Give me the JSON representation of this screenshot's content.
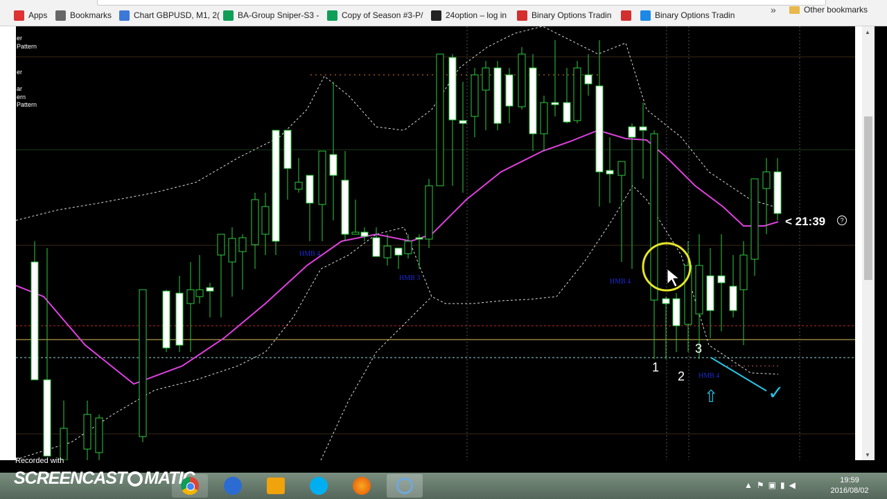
{
  "bookmarks": [
    {
      "label": "Apps",
      "icon": "apps-grid-icon",
      "color": "#d33"
    },
    {
      "label": "Bookmarks",
      "icon": "star-icon",
      "color": "#666"
    },
    {
      "label": "Chart GBPUSD, M1, 2(",
      "icon": "cap-icon",
      "color": "#3c78d8"
    },
    {
      "label": "BA-Group Sniper-S3 -",
      "icon": "sheet-icon",
      "color": "#0f9d58"
    },
    {
      "label": "Copy of Season #3-P/",
      "icon": "sheet-icon",
      "color": "#0f9d58"
    },
    {
      "label": "24option – log in",
      "icon": "24-icon",
      "color": "#222"
    },
    {
      "label": "Binary Options Tradin",
      "icon": "binary-icon",
      "color": "#d32f2f"
    },
    {
      "label": "",
      "icon": "binary-icon",
      "color": "#d32f2f"
    },
    {
      "label": "Binary Options Tradin",
      "icon": "up-arrow-icon",
      "color": "#1e88e5"
    }
  ],
  "bookmarks_overflow": "»",
  "other_bookmarks": "Other bookmarks",
  "chart_overlay": {
    "left_labels": [
      "er",
      "tern",
      "Pattern",
      "er",
      "ar",
      "ern",
      "Pattern"
    ],
    "timer": "< 21:39",
    "timer_help": "?",
    "numbers": [
      "1",
      "2",
      "3"
    ],
    "hmb_labels": [
      "HMB 4",
      "HMB 3",
      "HMB 4",
      "HMB 4"
    ]
  },
  "taskbar": {
    "recorded_with": "Recorded with",
    "logo": "SCREENCAST",
    "logo_end": "MATIC",
    "time": "19:59",
    "date": "2016/08/02"
  }
}
